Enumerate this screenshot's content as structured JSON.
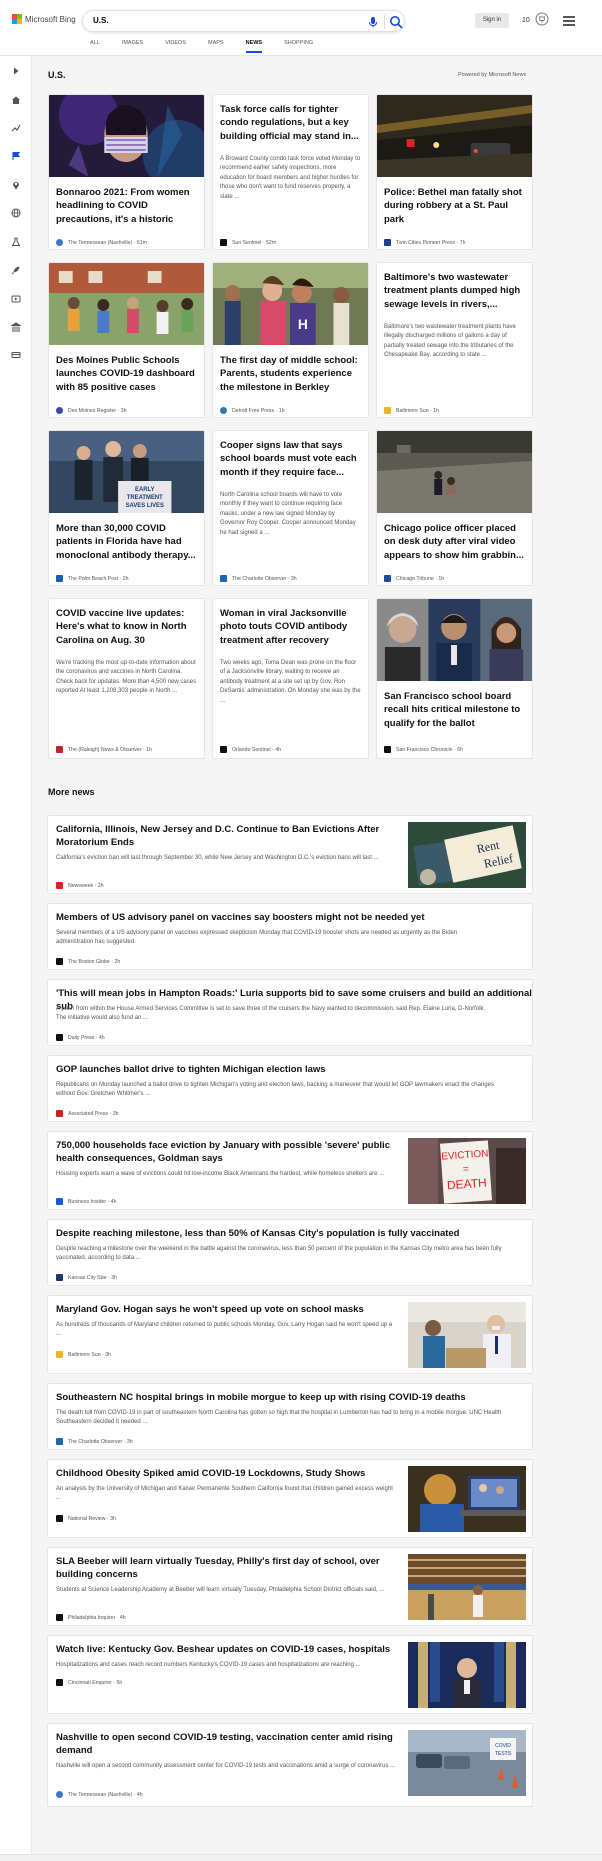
{
  "header": {
    "brand": "Microsoft Bing",
    "search_value": "U.S.",
    "sign_in": "Sign in",
    "rewards_count": "10",
    "scopes": [
      {
        "label": "ALL"
      },
      {
        "label": "IMAGES"
      },
      {
        "label": "VIDEOS"
      },
      {
        "label": "MAPS"
      },
      {
        "label": "NEWS"
      },
      {
        "label": "SHOPPING"
      }
    ],
    "active_scope": "NEWS",
    "accent_color": "#174ae4"
  },
  "main": {
    "section_title": "U.S.",
    "powered_by": "Powered by Microsoft News",
    "more_news_title": "More news"
  },
  "cards": [
    {
      "title": "Bonnaroo 2021: From women headlining to COVID precautions, it's a historic yea...",
      "source": "The Tennessean (Nashville)",
      "time": "51m",
      "image": "concert-crowd"
    },
    {
      "title": "Task force calls for tighter condo regulations, but a key building official may stand in...",
      "desc": "A Broward County condo task force voted Monday to recommend earlier safety inspections, more education for board members and higher hurdles for those who don't want to fund reserves properly, a slate ...",
      "source": "Sun Sentinel",
      "time": "52m"
    },
    {
      "title": "Police: Bethel man fatally shot during robbery at a St. Paul park",
      "source": "Twin Cities Pioneer Press",
      "time": "7h",
      "image": "night-scene"
    },
    {
      "title": "Des Moines Public Schools launches COVID-19 dashboard with 85 positive cases",
      "source": "Des Moines Register",
      "time": "3h",
      "image": "school-kids"
    },
    {
      "title": "The first day of middle school: Parents, students experience the milestone in Berkley",
      "source": "Detroit Free Press",
      "time": "1h",
      "image": "parent-student"
    },
    {
      "title": "Baltimore's two wastewater treatment plants dumped high sewage levels in rivers,...",
      "desc": "Baltimore's two wastewater treatment plants have illegally discharged millions of gallons a day of partially treated sewage into the tributaries of the Chesapeake Bay, according to state ...",
      "source": "Baltimore Sun",
      "time": "1h"
    },
    {
      "title": "More than 30,000 COVID patients in Florida have had monoclonal antibody therapy...",
      "source": "The Palm Beach Post",
      "time": "2h",
      "image": "press-podium",
      "sign_text": [
        "EARLY",
        "TREATMENT",
        "SAVES LIVES"
      ]
    },
    {
      "title": "Cooper signs law that says school boards must vote each month if they require face...",
      "desc": "North Carolina school boards will have to vote monthly if they want to continue requiring face masks, under a new law signed Monday by Governor Roy Cooper. Cooper announced Monday he had signed a ...",
      "source": "The Charlotte Observer",
      "time": "3h"
    },
    {
      "title": "Chicago police officer placed on desk duty after viral video appears to show him grabbin...",
      "source": "Chicago Tribune",
      "time": "1h",
      "image": "street-video"
    },
    {
      "title": "COVID vaccine live updates: Here's what to know in North Carolina on Aug. 30",
      "desc": "We're tracking the most up-to-date information about the coronavirus and vaccines in North Carolina. Check back for updates. More than 4,500 new cases reported At least 1,208,303 people in North ...",
      "source": "The (Raleigh) News & Observer",
      "time": "1h"
    },
    {
      "title": "Woman in viral Jacksonville photo touts COVID antibody treatment after recovery",
      "desc": "Two weeks ago, Toma Dean was prone on the floor of a Jacksonville library, waiting to receive an antibody treatment at a site set up by Gov. Ron DeSantis' administration. On Monday she was by the ...",
      "source": "Orlando Sentinel",
      "time": "4h"
    },
    {
      "title": "San Francisco school board recall hits critical milestone to qualify for the ballot",
      "source": "San Francisco Chronicle",
      "time": "6h",
      "image": "three-portraits"
    }
  ],
  "more_news": [
    {
      "title": "California, Illinois, New Jersey and D.C. Continue to Ban Evictions After Moratorium Ends",
      "desc": "California's eviction ban will last through September 30, while New Jersey and Washington D.C.'s eviction bans will last ...",
      "source": "Newsweek",
      "time": "2h",
      "image": "rent-relief",
      "image_text": [
        "Rent",
        "Relief"
      ]
    },
    {
      "title": "Members of US advisory panel on vaccines say boosters might not be needed yet",
      "desc": "Several members of a US advisory panel on vaccines expressed skepticism Monday that COVID-19 booster shots are needed as urgently as the Biden administration has suggested.",
      "source": "The Boston Globe",
      "time": "2h"
    },
    {
      "title": "'This will mean jobs in Hampton Roads:' Luria supports bid to save some cruisers and build an additional sub",
      "desc": "A push from within the House Armed Services Committee is set to save three of the cruisers the Navy wanted to decommission, said Rep. Elaine Luria, D-Norfolk. The initiative would also fund an ...",
      "source": "Daily Press",
      "time": "4h"
    },
    {
      "title": "GOP launches ballot drive to tighten Michigan election laws",
      "desc": "Republicans on Monday launched a ballot drive to tighten Michigan's voting and election laws, backing a maneuver that would let GOP lawmakers enact the changes without Gov. Gretchen Whitmer's ...",
      "source": "Associated Press",
      "time": "3h"
    },
    {
      "title": "750,000 households face eviction by January with possible 'severe' public health consequences, Goldman says",
      "desc": "Housing experts warn a wave of evictions could hit low-income Black Americans the hardest, while homeless shelters are ...",
      "source": "Business Insider",
      "time": "4h",
      "image": "eviction-sign",
      "image_text": [
        "EVICTION",
        "=",
        "DEATH"
      ]
    },
    {
      "title": "Despite reaching milestone, less than 50% of Kansas City's population is fully vaccinated",
      "desc": "Despite reaching a milestone over the weekend in the battle against the coronavirus, less than 50 percent of the population in the Kansas City metro area has been fully vaccinated, according to data ...",
      "source": "Kansas City Star",
      "time": "3h"
    },
    {
      "title": "Maryland Gov. Hogan says he won't speed up vote on school masks",
      "desc": "As hundreds of thousands of Maryland children returned to public schools Monday, Gov. Larry Hogan said he won't speed up a ...",
      "source": "Baltimore Sun",
      "time": "3h",
      "image": "classroom"
    },
    {
      "title": "Southeastern NC hospital brings in mobile morgue to keep up with rising COVID-19 deaths",
      "desc": "The death toll from COVID-19 in part of southeastern North Carolina has gotten so high that the hospital in Lumberton has had to bring in a mobile morgue. UNC Health Southeastern decided it needed ...",
      "source": "The Charlotte Observer",
      "time": "3h"
    },
    {
      "title": "Childhood Obesity Spiked amid COVID-19 Lockdowns, Study Shows",
      "desc": "An analysis by the University of Michigan and Kaiser Permanente Southern California found that children gained excess weight ...",
      "source": "National Review",
      "time": "3h",
      "image": "child-laptop"
    },
    {
      "title": "SLA Beeber will learn virtually Tuesday, Philly's first day of school, over building concerns",
      "desc": "Students at Science Leadership Academy at Beeber will learn virtually Tuesday, Philadelphia School District officials said, ...",
      "source": "Philadelphia Inquirer",
      "time": "4h",
      "image": "gym"
    },
    {
      "title": "Watch live: Kentucky Gov. Beshear updates on COVID-19 cases, hospitals",
      "desc": "Hospitalizations and cases reach record numbers Kentucky's COVID-19 cases and hospitalizations are reaching ...",
      "source": "Cincinnati Enquirer",
      "time": "5h",
      "image": "governor"
    },
    {
      "title": "Nashville to open second COVID-19 testing, vaccination center amid rising demand",
      "desc": "Nashville will open a second community assessment center for COVID-19 tests and vaccinations amid a surge of coronavirus ...",
      "source": "The Tennessean (Nashville)",
      "time": "4h",
      "image": "testing-site",
      "image_text": [
        "COVID",
        "TESTS"
      ]
    }
  ]
}
